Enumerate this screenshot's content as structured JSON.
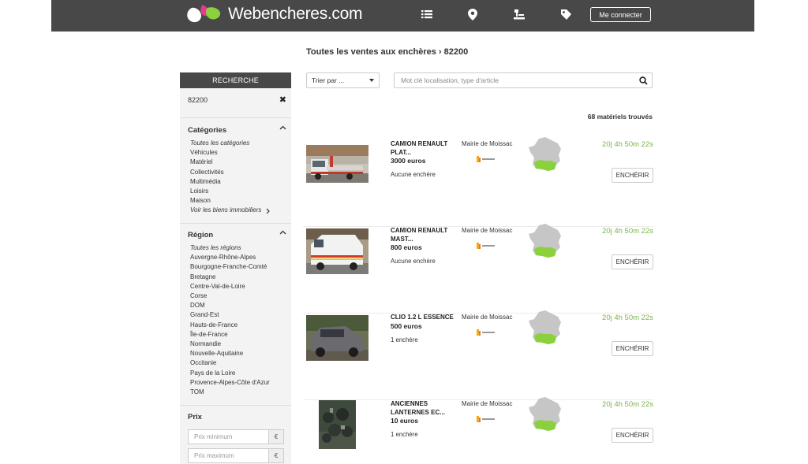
{
  "header": {
    "brand": "Webencheres.com",
    "login_label": "Me connecter",
    "icons": [
      "list-icon",
      "location-pin-icon",
      "gavel-icon",
      "tag-icon"
    ]
  },
  "breadcrumb": "Toutes les ventes aux enchères › 82200",
  "sidebar": {
    "title": "RECHERCHE",
    "search_value": "82200",
    "categories": {
      "title": "Catégories",
      "items": [
        "Toutes les catégories",
        "Véhicules",
        "Matériel",
        "Collectivités",
        "Multimédia",
        "Loisirs",
        "Maison"
      ],
      "more": "Voir les biens immobiliers"
    },
    "region": {
      "title": "Région",
      "items": [
        "Toutes les régions",
        "Auvergne-Rhône-Alpes",
        "Bourgogne-Franche-Comté",
        "Bretagne",
        "Centre-Val-de-Loire",
        "Corse",
        "DOM",
        "Grand-Est",
        "Hauts-de-France",
        "Île-de-France",
        "Normandie",
        "Nouvelle-Aquitaine",
        "Occitanie",
        "Pays de la Loire",
        "Provence-Alpes-Côte d'Azur",
        "TOM"
      ]
    },
    "price": {
      "title": "Prix",
      "min_placeholder": "Prix minimum",
      "max_placeholder": "Prix maximum",
      "currency": "€"
    }
  },
  "controls": {
    "sort_label": "Trier par ...",
    "search_placeholder": "Mot clé localisation, type d'article"
  },
  "results_count": "68 matériels trouvés",
  "listings": [
    {
      "name": "CAMION RENAULT PLAT...",
      "price": "3000 euros",
      "bids": "Aucune enchère",
      "seller": "Mairie de Moissac",
      "timer": "20j 4h 50m 22s",
      "action": "ENCHÉRIR"
    },
    {
      "name": "CAMION RENAULT MAST...",
      "price": "800 euros",
      "bids": "Aucune enchère",
      "seller": "Mairie de Moissac",
      "timer": "20j 4h 50m 22s",
      "action": "ENCHÉRIR"
    },
    {
      "name": "CLIO 1.2 L ESSENCE",
      "price": "500 euros",
      "bids": "1 enchère",
      "seller": "Mairie de Moissac",
      "timer": "20j 4h 50m 22s",
      "action": "ENCHÉRIR"
    },
    {
      "name": "ANCIENNES LANTERNES EC...",
      "price": "10 euros",
      "bids": "1 enchère",
      "seller": "Mairie de Moissac",
      "timer": "20j 4h 50m 22s",
      "action": "ENCHÉRIR"
    }
  ],
  "colors": {
    "header_bg": "#484848",
    "timer_green": "#7ab648",
    "map_highlight": "#8bd13d",
    "sidebar_bg": "#f3f3f3"
  }
}
